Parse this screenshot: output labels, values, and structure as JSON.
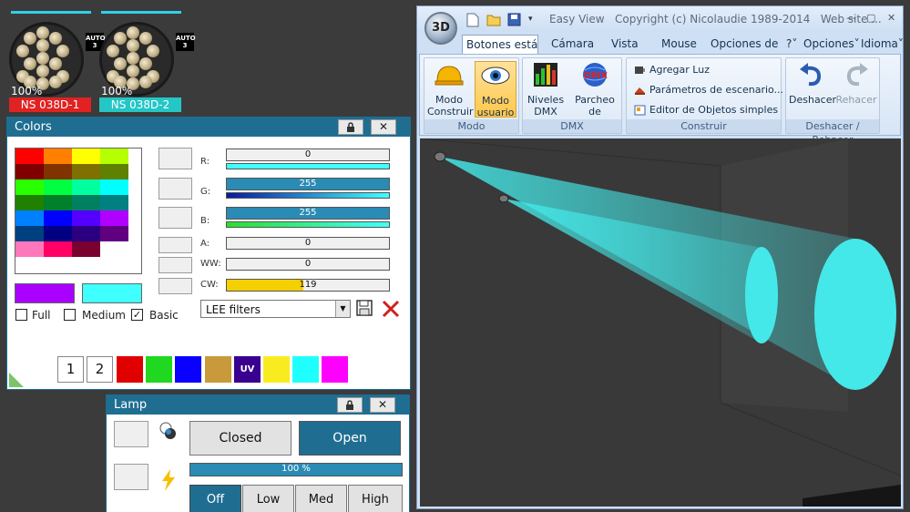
{
  "fixtures": [
    {
      "name": "NS 038D-1",
      "percent": "100%",
      "auto_label": "AUTO\n3",
      "name_color": "#e02222",
      "selection_color": "#2fd0e8"
    },
    {
      "name": "NS 038D-2",
      "percent": "100%",
      "auto_label": "AUTO\n3",
      "name_color": "#24c6c6",
      "selection_color": "#2fd0e8"
    }
  ],
  "colors_panel": {
    "title": "Colors",
    "lock_icon": "lock-icon",
    "close_label": "✕",
    "palette": [
      [
        "#ff0000",
        "#ff8000",
        "#ffff00",
        "#b5ff00"
      ],
      [
        "#800000",
        "#803300",
        "#807000",
        "#5f8000"
      ],
      [
        "#2aff00",
        "#00ff40",
        "#00ff9f",
        "#00ffff"
      ],
      [
        "#208000",
        "#00802a",
        "#008060",
        "#008080"
      ],
      [
        "#0080ff",
        "#0000ff",
        "#5500ff",
        "#b000ff"
      ],
      [
        "#004080",
        "#000080",
        "#2a0080",
        "#600080"
      ],
      [
        "#ff77bb",
        "#ff0066",
        "#7a0030",
        "#ffffff"
      ]
    ],
    "prev_color": "#aa00ff",
    "current_color": "#40ffff",
    "channels": [
      {
        "label": "R:",
        "value": "0",
        "fraction": 0,
        "fill": "#1f6e92",
        "thin_color": "#40ffff"
      },
      {
        "label": "G:",
        "value": "255",
        "fraction": 1,
        "fill": "#2a8bb5",
        "thin_color": "#1836d8"
      },
      {
        "label": "B:",
        "value": "255",
        "fraction": 1,
        "fill": "#2a8bb5",
        "thin_color": "#2ae02a"
      },
      {
        "label": "A:",
        "value": "0",
        "fraction": 0,
        "fill": "#2a8bb5"
      },
      {
        "label": "WW:",
        "value": "0",
        "fraction": 0,
        "fill": "#2a8bb5"
      },
      {
        "label": "CW:",
        "value": "119",
        "fraction": 0.47,
        "fill": "#f5d000"
      }
    ],
    "checkboxes": [
      {
        "label": "Full",
        "checked": false,
        "mark": ""
      },
      {
        "label": "Medium",
        "checked": false,
        "mark": ""
      },
      {
        "label": "Basic",
        "checked": true,
        "mark": "✓"
      }
    ],
    "filter_select": "LEE filters",
    "preset_buttons": [
      "1",
      "2"
    ],
    "swatches": [
      "#e00000",
      "#1fd81f",
      "#0a00ff",
      "#c89a3a",
      "#3a0090",
      "#f8ec20",
      "#20ffff",
      "#ff00ff"
    ],
    "uv_label": "UV"
  },
  "lamp_panel": {
    "title": "Lamp",
    "close_label": "✕",
    "closed_label": "Closed",
    "open_label": "Open",
    "progress_text": "100 %",
    "progress": 1,
    "power_buttons": [
      "Off",
      "Low",
      "Med",
      "High"
    ]
  },
  "easyview": {
    "title": "Easy View",
    "copyright": "Copyright (c) Nicolaudie 1989-2014",
    "web": "Web site ...",
    "logo": "3D",
    "tabs": [
      "Botones están",
      "Cámara",
      "Vista",
      "Mouse",
      "Opciones de re",
      "?",
      "Opciones",
      "Idioma"
    ],
    "groups": {
      "modo": {
        "label": "Modo",
        "buttons": [
          "Modo Construir",
          "Modo usuario"
        ]
      },
      "dmx": {
        "label": "DMX",
        "buttons": [
          "Niveles DMX",
          "Parcheo de Universos"
        ]
      },
      "construir": {
        "label": "Construir",
        "items": [
          "Agregar Luz",
          "Parámetros de escenario...",
          "Editor de Objetos simples"
        ]
      },
      "undo": {
        "label": "Deshacer / Rehacer",
        "buttons": [
          "Deshacer",
          "Rehacer"
        ]
      }
    },
    "beam_color": "#45e8e8"
  }
}
